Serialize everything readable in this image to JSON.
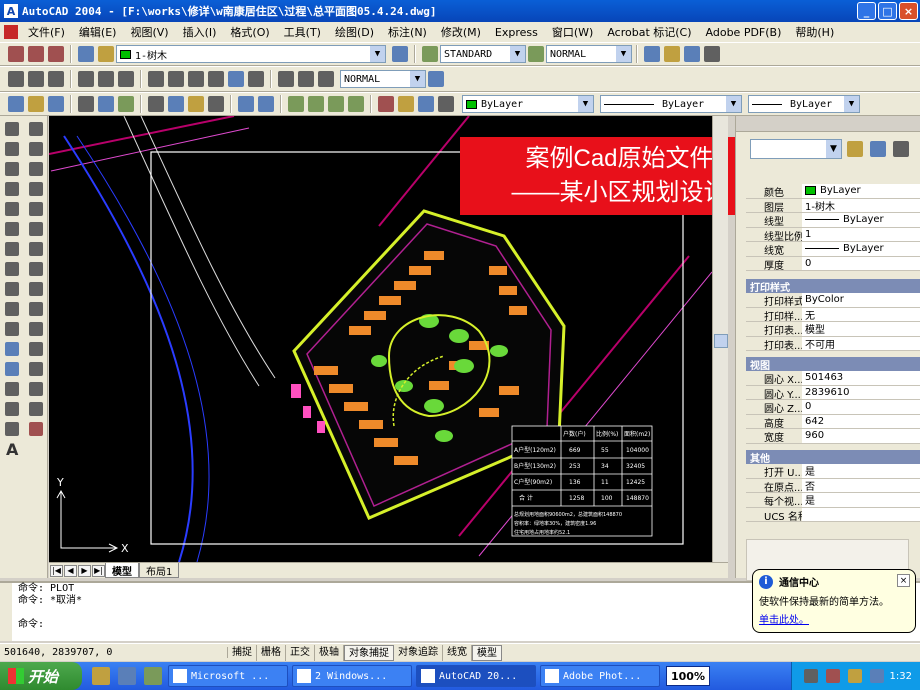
{
  "window": {
    "app_icon": "A",
    "title": "AutoCAD 2004 - [F:\\works\\修详\\w南康居住区\\过程\\总平面图05.4.24.dwg]",
    "buttons": {
      "minimize": "_",
      "restore": "□",
      "close": "×"
    }
  },
  "menu": [
    "文件(F)",
    "编辑(E)",
    "视图(V)",
    "插入(I)",
    "格式(O)",
    "工具(T)",
    "绘图(D)",
    "标注(N)",
    "修改(M)",
    "Express",
    "窗口(W)",
    "Acrobat 标记(C)",
    "Adobe PDF(B)",
    "帮助(H)"
  ],
  "toolbar": {
    "layer": "1-树木",
    "text_style": "STANDARD",
    "dim_style": "NORMAL",
    "plot_style": "NORMAL",
    "color": "ByLayer",
    "linetype": "ByLayer",
    "lineweight": "ByLayer",
    "color_hex": "#00c000"
  },
  "overlay": {
    "line1": "案例Cad原始文件",
    "line2": "——某小区规划设计"
  },
  "canvas": {
    "ucs_y": "Y",
    "ucs_x": "X"
  },
  "tabs": [
    "模型",
    "布局1"
  ],
  "properties": {
    "general": [
      {
        "k": "颜色",
        "v": "ByLayer"
      },
      {
        "k": "图层",
        "v": "1-树木"
      },
      {
        "k": "线型",
        "v": "ByLayer"
      },
      {
        "k": "线型比例",
        "v": "1"
      },
      {
        "k": "线宽",
        "v": "ByLayer"
      },
      {
        "k": "厚度",
        "v": "0"
      }
    ],
    "plot_header": "打印样式",
    "plot": [
      {
        "k": "打印样式",
        "v": "ByColor"
      },
      {
        "k": "打印样...",
        "v": "无"
      },
      {
        "k": "打印表...",
        "v": "模型"
      },
      {
        "k": "打印表...",
        "v": "不可用"
      }
    ],
    "view_header": "视图",
    "view": [
      {
        "k": "圆心 X...",
        "v": "501463"
      },
      {
        "k": "圆心 Y...",
        "v": "2839610"
      },
      {
        "k": "圆心 Z...",
        "v": "0"
      },
      {
        "k": "高度",
        "v": "642"
      },
      {
        "k": "宽度",
        "v": "960"
      }
    ],
    "misc_header": "其他",
    "misc": [
      {
        "k": "打开 U...",
        "v": "是"
      },
      {
        "k": "在原点...",
        "v": "否"
      },
      {
        "k": "每个视...",
        "v": "是"
      },
      {
        "k": "UCS 名称",
        "v": ""
      }
    ]
  },
  "commands": [
    "命令:  PLOT",
    "命令: *取消*",
    "",
    "命令:"
  ],
  "balloon": {
    "title": "通信中心",
    "body": "使软件保持最新的简单方法。",
    "link": "单击此处。",
    "info": "i",
    "close": "×"
  },
  "status": {
    "coords": "501640, 2839707, 0",
    "buttons": [
      "捕捉",
      "栅格",
      "正交",
      "极轴",
      "对象捕捉",
      "对象追踪",
      "线宽",
      "模型"
    ]
  },
  "taskbar": {
    "start": "开始",
    "tasks": [
      "Microsoft ...",
      "2 Windows...",
      "AutoCAD 20...",
      "Adobe Phot..."
    ],
    "zoom": "100%",
    "time": "1:32"
  },
  "table": {
    "headers": [
      "",
      "户数(户)",
      "比例(%)",
      "面积(m2)"
    ],
    "rows": [
      [
        "A户型(120m2)",
        "669",
        "55",
        "104000"
      ],
      [
        "B户型(130m2)",
        "253",
        "34",
        "32405"
      ],
      [
        "C户型(90m2)",
        "136",
        "11",
        "12425"
      ],
      [
        "合 计",
        "1258",
        "100",
        "148870"
      ]
    ],
    "notes": [
      "总规划用地面积90600m2，总建筑面积148870",
      "容积率：绿地率30%，建筑密度1.96",
      "住宅用地占用地率约52.1"
    ]
  }
}
